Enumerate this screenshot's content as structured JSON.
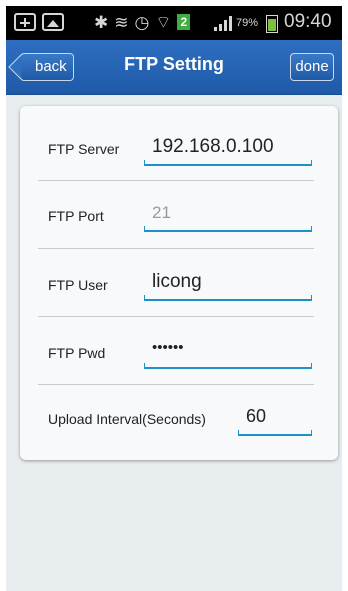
{
  "status_bar": {
    "battery": "79%",
    "time": "09:40",
    "sim_badge": "2"
  },
  "nav": {
    "back_label": "back",
    "title": "FTP Setting",
    "done_label": "done"
  },
  "form": {
    "server": {
      "label": "FTP Server",
      "value": "192.168.0.100"
    },
    "port": {
      "label": "FTP Port",
      "placeholder": "21"
    },
    "user": {
      "label": "FTP User",
      "value": "licong"
    },
    "pwd": {
      "label": "FTP Pwd",
      "value": "••••••"
    },
    "interval": {
      "label": "Upload Interval(Seconds)",
      "value": "60"
    }
  },
  "colors": {
    "nav_bar": "#2566b6",
    "accent_underline": "#1e90c8",
    "background": "#e7ecef"
  }
}
